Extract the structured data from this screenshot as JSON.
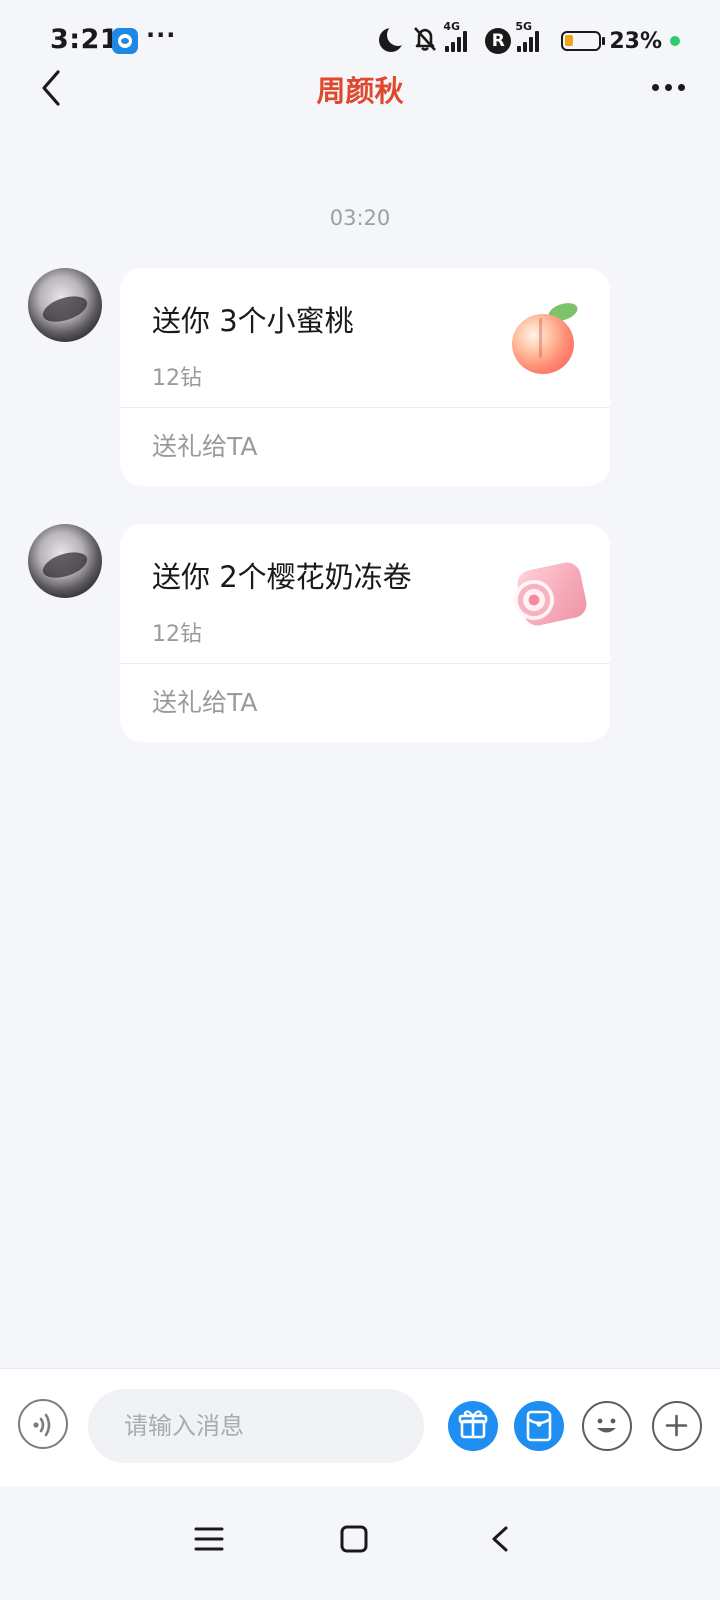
{
  "status_bar": {
    "time": "3:21",
    "more": "···",
    "net_4g": "4G",
    "net_5g": "5G",
    "roaming_badge": "R",
    "battery_percent": "23%",
    "battery_level": 0.23
  },
  "header": {
    "title": "周颜秋"
  },
  "chat": {
    "timestamp": "03:20",
    "messages": [
      {
        "gift_title": "送你 3个小蜜桃",
        "price": "12钻",
        "action_label": "送礼给TA",
        "icon": "peach-icon"
      },
      {
        "gift_title": "送你 2个樱花奶冻卷",
        "price": "12钻",
        "action_label": "送礼给TA",
        "icon": "sakura-roll-icon"
      }
    ]
  },
  "input_bar": {
    "placeholder": "请输入消息"
  },
  "colors": {
    "title": "#e0482d",
    "accent_blue": "#1e8ff0",
    "background": "#f4f6f9"
  }
}
